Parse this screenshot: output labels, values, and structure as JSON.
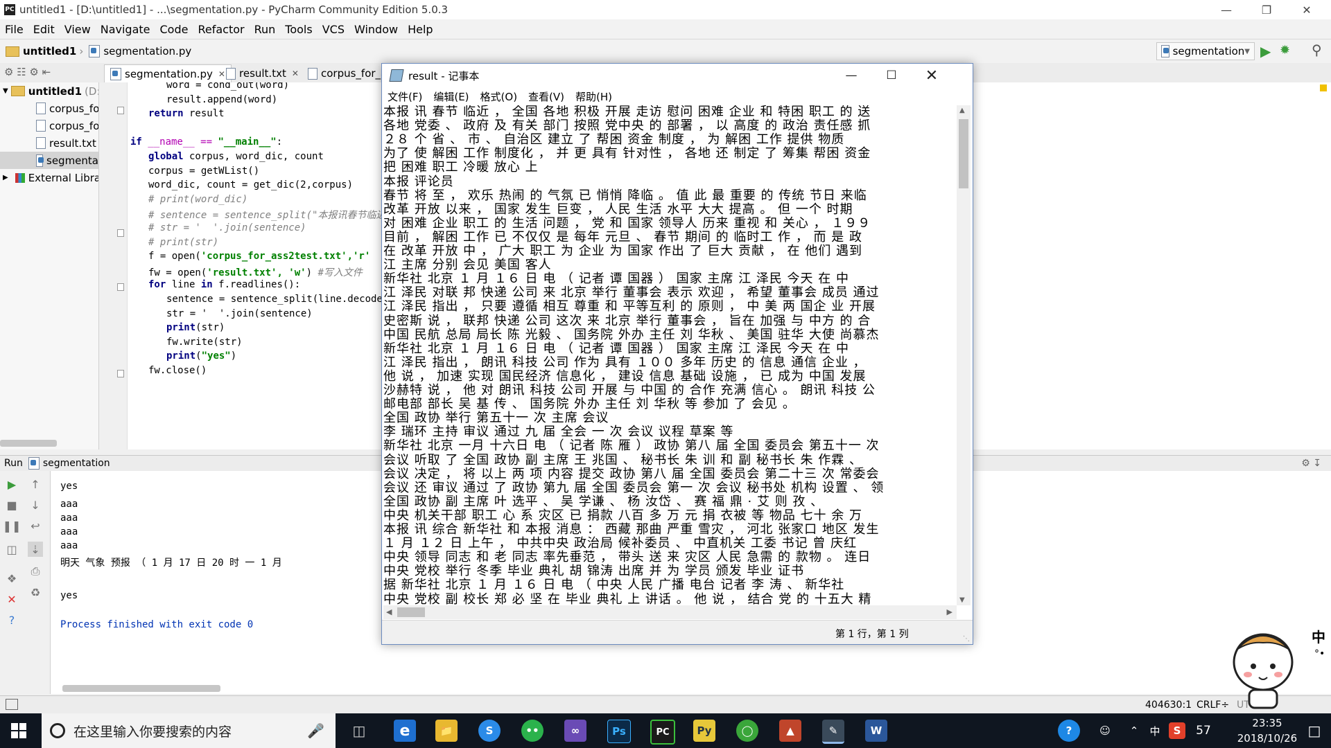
{
  "pycharm": {
    "title": "untitled1 - [D:\\untitled1] - ...\\segmentation.py - PyCharm Community Edition 5.0.3",
    "app_icon": "PC",
    "menu": [
      "File",
      "Edit",
      "View",
      "Navigate",
      "Code",
      "Refactor",
      "Run",
      "Tools",
      "VCS",
      "Window",
      "Help"
    ],
    "breadcrumb": {
      "project": "untitled1",
      "file": "segmentation.py"
    },
    "run_config": "segmentation",
    "editor_tabs": [
      "segmentation.py",
      "result.txt",
      "corpus_for_as"
    ],
    "project_tree": {
      "root": "untitled1",
      "root_hint": "(D:",
      "items": [
        "corpus_fo",
        "corpus_fo",
        "result.txt",
        "segmenta"
      ],
      "external": "External Libra"
    },
    "code_lines": [
      {
        "indent": 2,
        "text": "word = cond_out(word)"
      },
      {
        "indent": 2,
        "text": "result.append(word)"
      },
      {
        "indent": 1,
        "kw": "return",
        "text": " result"
      },
      {
        "indent": 0,
        "text": ""
      },
      {
        "indent": 0,
        "kw": "if",
        "text": " __name__ == ",
        "str": "\"__main__\"",
        "tail": ":"
      },
      {
        "indent": 1,
        "kw": "global",
        "text": " corpus, word_dic, count"
      },
      {
        "indent": 1,
        "text": "corpus = getWList()"
      },
      {
        "indent": 1,
        "text": "word_dic, count = get_dic(2,corpus)"
      },
      {
        "indent": 1,
        "cm": "# print(word_dic)"
      },
      {
        "indent": 1,
        "cm": "# sentence = sentence_split(\"本报讯春节临近"
      },
      {
        "indent": 1,
        "cm": "# str = '  '.join(sentence)"
      },
      {
        "indent": 1,
        "cm": "# print(str)"
      },
      {
        "indent": 1,
        "text": "f = open(",
        "str": "'corpus_for_ass2test.txt','r'",
        "tail": ""
      },
      {
        "indent": 1,
        "text": "fw = open(",
        "str": "'result.txt', 'w'",
        "tail": ") ",
        "cm": "#写入文件"
      },
      {
        "indent": 1,
        "kw": "for",
        "text": " line ",
        "kw2": "in",
        "tail": " f.readlines():"
      },
      {
        "indent": 2,
        "text": "sentence = sentence_split(line.decode("
      },
      {
        "indent": 2,
        "text": "str = '  '.join(sentence)"
      },
      {
        "indent": 2,
        "kw": "print",
        "text": "(str)"
      },
      {
        "indent": 2,
        "text": "fw.write(str)"
      },
      {
        "indent": 2,
        "kw": "print",
        "text": "(",
        "str": "\"yes\"",
        "tail": ")"
      },
      {
        "indent": 1,
        "text": "fw.close()"
      }
    ],
    "run_panel": {
      "label": "Run",
      "config": "segmentation",
      "console": [
        "yes",
        "aaa",
        "aaa",
        "aaa",
        "aaa",
        "明天 气象 预报 （ 1 月 17 日 20 时 一 1 月",
        "",
        "yes",
        "",
        "Process finished with exit code 0"
      ]
    },
    "statusbar": {
      "position": "404630:1",
      "line_sep": "CRLF÷",
      "encoding": "UTF"
    }
  },
  "notepad": {
    "title": "result - 记事本",
    "menu": [
      "文件(F)",
      "编辑(E)",
      "格式(O)",
      "查看(V)",
      "帮助(H)"
    ],
    "status": "第 1 行，第 1 列",
    "lines": [
      "本报 讯 春节 临近 ， 全国 各地 积极 开展 走访 慰问 困难 企业 和 特困 职工 的 送",
      "各地 党委 、 政府 及 有关 部门 按照 党中央 的 部署 ， 以 高度 的 政治 责任感 抓",
      "２８ 个 省 、 市 、 自治区 建立 了 帮困 资金 制度 ， 为 解困 工作 提供 物质",
      "为了 使 解困 工作 制度化 ， 并 更 具有 针对性 ， 各地 还 制定 了 筹集 帮困 资金",
      "把 困难 职工 冷暖 放心 上",
      "本报 评论员",
      "春节 将 至 ， 欢乐 热闹 的 气氛 已 悄悄 降临 。 值 此 最 重要 的 传统 节日 来临",
      "改革 开放 以来 ， 国家 发生 巨变 ， 人民 生活 水平 大大 提高 。 但 一个 时期",
      "对 困难 企业 职工 的 生活 问题 ， 党 和 国家 领导人 历来 重视 和 关心 ， １９９",
      "目前 ， 解困 工作 已 不仅仅 是 每年 元旦 、 春节 期间 的 临时工 作 ， 而 是 政",
      "在 改革 开放 中 ， 广大 职工 为 企业 为 国家 作出 了 巨大 贡献 ， 在 他们 遇到",
      "江 主席 分别 会见 美国 客人",
      "新华社 北京 １ 月 １６ 日 电 （ 记者 谭 国器 ） 国家 主席 江 泽民 今天 在 中",
      "江 泽民 对联 邦 快递 公司 来 北京 举行 董事会 表示 欢迎 ， 希望 董事会 成员 通过",
      "江 泽民 指出 ， 只要 遵循 相互 尊重 和 平等互利 的 原则 ， 中 美 两 国企 业 开展",
      "史密斯 说 ， 联邦 快递 公司 这次 来 北京 举行 董事会 ， 旨在 加强 与 中方 的 合",
      "中国 民航 总局 局长 陈 光毅 、 国务院 外办 主任 刘 华秋 、 美国 驻华 大使 尚慕杰",
      "新华社 北京 １ 月 １６ 日 电 （ 记者 谭 国器 ） 国家 主席 江 泽民 今天 在 中",
      "江 泽民 指出 ， 朗讯 科技 公司 作为 具有 １００ 多年 历史 的 信息 通信 企业 ，",
      "他 说 ， 加速 实现 国民经济 信息化 ， 建设 信息 基础 设施 ， 已 成为 中国 发展",
      "沙赫特 说 ， 他 对 朗讯 科技 公司 开展 与 中国 的 合作 充满 信心 。 朗讯 科技 公",
      "邮电部 部长 吴 基 传 、 国务院 外办 主任 刘 华秋 等 参加 了 会见 。",
      "全国 政协 举行 第五十一 次 主席 会议",
      "李 瑞环 主持 审议 通过 九 届 全会 一 次 会议 议程 草案 等",
      "新华社 北京 一月 十六日 电 （ 记者 陈 雁 ） 政协 第八 届 全国 委员会 第五十一 次",
      "会议 听取 了 全国 政协 副 主席 王 兆国 、 秘书长 朱 训 和 副 秘书长 朱 作霖 、",
      "会议 决定 ， 将 以上 两 项 内容 提交 政协 第八 届 全国 委员会 第二十三 次 常委会",
      "会议 还 审议 通过 了 政协 第九 届 全国 委员会 第一 次 会议 秘书处 机构 设置 、 领",
      "全国 政协 副 主席 叶 选平 、 吴 学谦 、 杨 汝岱 、 赛 福 鼎 · 艾 则 孜 、",
      "中央 机关干部 职工 心 系 灾区 已 捐款 八百 多 万 元 捐 衣被 等 物品 七十 余 万",
      "本报 讯 综合 新华社 和 本报 消息 ： 西藏 那曲 严重 雪灾 ， 河北 张家口 地区 发生",
      "１ 月 １２ 日 上午 ， 中共中央 政治局 候补委员 、 中直机关 工委 书记 曾 庆红",
      "中央 领导 同志 和 老 同志 率先垂范 ， 带头 送 来 灾区 人民 急需 的 款物 。 连日",
      "中央 党校 举行 冬季 毕业 典礼 胡 锦涛 出席 并 为 学员 颁发 毕业 证书",
      "据 新华社 北京 １ 月 １６ 日 电 （ 中央 人民 广播 电台 记者 李 涛 、 新华社",
      "中央 党校 副 校长 郑 必 坚 在 毕业 典礼 上 讲话 。 他 说 ， 结合 党 的 十五大 精"
    ]
  },
  "taskbar": {
    "search_placeholder": "在这里输入你要搜索的内容",
    "time": "23:35",
    "date": "2018/10/26",
    "ime": "中",
    "tray_num": "57",
    "apps": [
      "edge-icon",
      "explorer-icon",
      "sogou-icon",
      "wechat-icon",
      "visualstudio-icon",
      "photoshop-icon",
      "pycharm-icon",
      "python-icon",
      "chrome-icon",
      "matlab-icon",
      "notepad-icon",
      "word-icon"
    ]
  },
  "colors": {
    "accent": "#0078d7",
    "keyword": "#000080",
    "string": "#008000",
    "comment": "#808080",
    "run_green": "#3c9c3c"
  }
}
